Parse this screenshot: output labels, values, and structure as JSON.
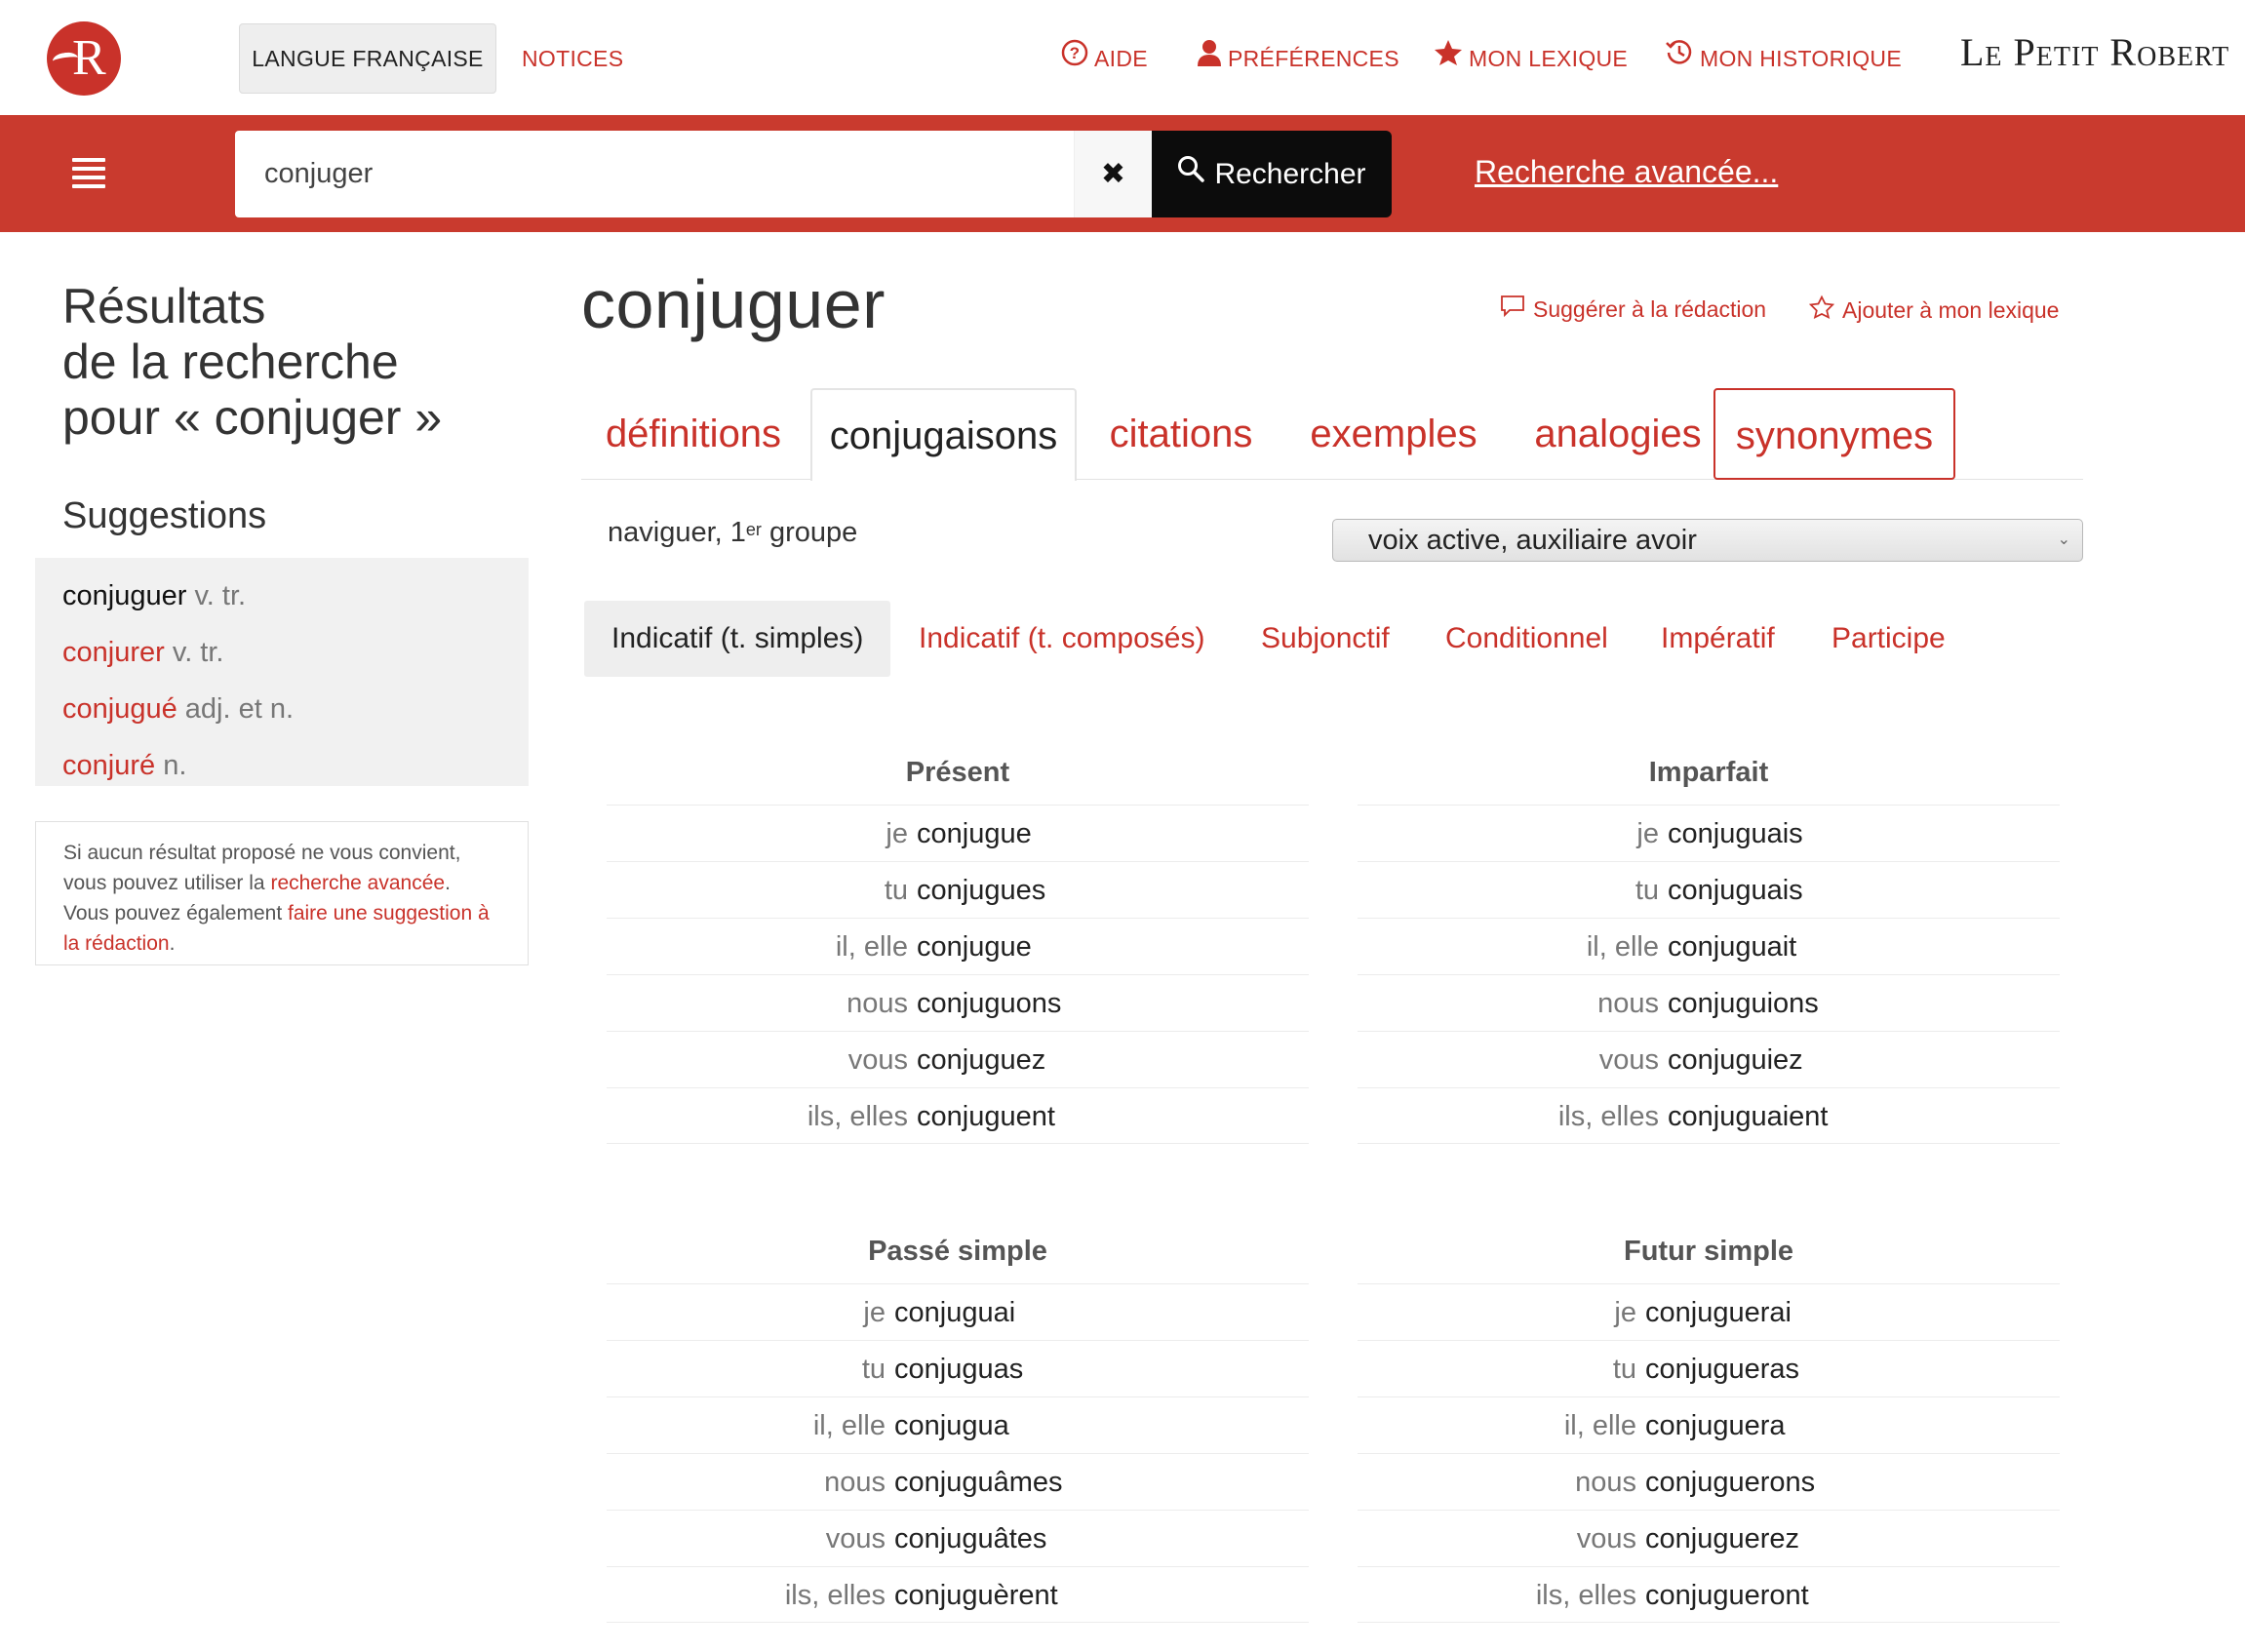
{
  "header": {
    "nav_lang": "LANGUE FRANÇAISE",
    "nav_notices": "NOTICES",
    "links": [
      "AIDE",
      "PRÉFÉRENCES",
      "MON LEXIQUE",
      "MON HISTORIQUE"
    ],
    "brand": "Le Petit Robert",
    "accent_color": "#c9322a"
  },
  "search": {
    "value": "conjuger",
    "clear_symbol": "✖",
    "button": "Rechercher",
    "advanced": "Recherche avancée..."
  },
  "sidebar": {
    "results_title": [
      "Résultats",
      "de la recherche",
      "pour « conjuger »"
    ],
    "suggestions_title": "Suggestions",
    "suggestions": [
      {
        "word": "conjuguer",
        "cat": "v. tr."
      },
      {
        "word": "conjurer",
        "cat": "v. tr."
      },
      {
        "word": "conjugué",
        "cat": "adj. et n."
      },
      {
        "word": "conjuré",
        "cat": "n."
      }
    ],
    "note": {
      "p1": "Si aucun résultat proposé ne vous convient, vous pouvez utiliser la ",
      "link1": "recherche avancée",
      "p2": ". Vous pouvez également ",
      "link2": "faire une suggestion à la rédaction",
      "p3": "."
    }
  },
  "entry": {
    "headword": "conjuguer",
    "suggest": "Suggérer à la rédaction",
    "add": "Ajouter à mon lexique",
    "tabs": [
      "définitions",
      "conjugaisons",
      "citations",
      "exemples",
      "analogies",
      "synonymes"
    ],
    "group_prefix": "naviguer, 1",
    "group_sup": "er",
    "group_suffix": " groupe",
    "voice": "voix active, auxiliaire avoir",
    "moods": [
      "Indicatif (t. simples)",
      "Indicatif (t. composés)",
      "Subjonctif",
      "Conditionnel",
      "Impératif",
      "Participe"
    ]
  },
  "tenses": [
    {
      "name": "Présent",
      "rows": [
        [
          "je",
          "conjugue"
        ],
        [
          "tu",
          "conjugues"
        ],
        [
          "il, elle",
          "conjugue"
        ],
        [
          "nous",
          "conjuguons"
        ],
        [
          "vous",
          "conjuguez"
        ],
        [
          "ils, elles",
          "conjuguent"
        ]
      ]
    },
    {
      "name": "Imparfait",
      "rows": [
        [
          "je",
          "conjuguais"
        ],
        [
          "tu",
          "conjuguais"
        ],
        [
          "il, elle",
          "conjuguait"
        ],
        [
          "nous",
          "conjuguions"
        ],
        [
          "vous",
          "conjuguiez"
        ],
        [
          "ils, elles",
          "conjuguaient"
        ]
      ]
    },
    {
      "name": "Passé simple",
      "rows": [
        [
          "je",
          "conjuguai"
        ],
        [
          "tu",
          "conjuguas"
        ],
        [
          "il, elle",
          "conjugua"
        ],
        [
          "nous",
          "conjuguâmes"
        ],
        [
          "vous",
          "conjuguâtes"
        ],
        [
          "ils, elles",
          "conjuguèrent"
        ]
      ]
    },
    {
      "name": "Futur simple",
      "rows": [
        [
          "je",
          "conjuguerai"
        ],
        [
          "tu",
          "conjugueras"
        ],
        [
          "il, elle",
          "conjuguera"
        ],
        [
          "nous",
          "conjuguerons"
        ],
        [
          "vous",
          "conjuguerez"
        ],
        [
          "ils, elles",
          "conjugueront"
        ]
      ]
    }
  ]
}
